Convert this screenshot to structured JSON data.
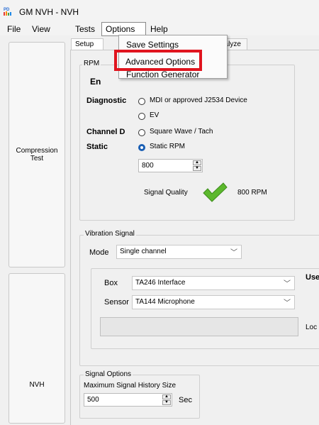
{
  "window": {
    "title": "GM NVH - NVH",
    "icon_text": "PD"
  },
  "menu": {
    "file": "File",
    "view": "View",
    "tests": "Tests",
    "options": "Options",
    "help": "Help"
  },
  "options_menu": {
    "items": [
      "Save Settings",
      "Advanced Options",
      "Function Generator"
    ]
  },
  "sidebar": {
    "compression_line1": "Compression",
    "compression_line2": "Test",
    "nvh": "NVH"
  },
  "tabs": {
    "setup": "Setup",
    "analyze": "nalyze"
  },
  "rpm": {
    "group_label": "RPM",
    "engine_label_fragment": "En",
    "diagnostic_label": "Diagnostic",
    "diagnostic_opt1": "MDI or approved J2534 Device",
    "diagnostic_opt2": "EV",
    "channel_label": "Channel D",
    "channel_opt": "Square Wave / Tach",
    "static_label": "Static",
    "static_opt": "Static RPM",
    "static_value": "800",
    "signal_quality_label": "Signal Quality",
    "signal_quality_value": "800 RPM",
    "colors": {
      "check": "#5cb82d",
      "radio_selected": "#1a5fb4"
    }
  },
  "vibration": {
    "group_label": "Vibration Signal",
    "mode_label": "Mode",
    "mode_value": "Single channel",
    "box_label": "Box",
    "box_value": "TA246 Interface",
    "sensor_label": "Sensor",
    "sensor_value": "TA144 Microphone",
    "use_fragment": "Use",
    "loc_fragment": "Loc"
  },
  "signal_options": {
    "group_label": "Signal Options",
    "history_label": "Maximum Signal History Size",
    "history_value": "500",
    "unit": "Sec"
  },
  "highlight_color": "#e0141e"
}
